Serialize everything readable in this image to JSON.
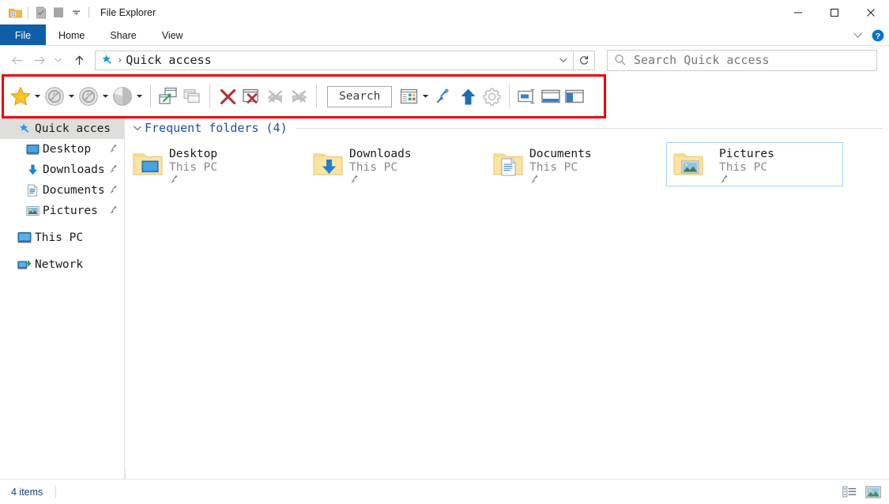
{
  "window": {
    "title": "File Explorer",
    "quick_access_toolbar": [
      {
        "name": "folder-icon",
        "label": "File Explorer"
      },
      {
        "name": "properties-icon",
        "label": "Properties"
      },
      {
        "name": "new-folder-icon",
        "label": "New folder"
      },
      {
        "name": "chevron-down-icon",
        "label": "Customize Quick Access Toolbar"
      }
    ],
    "controls": {
      "minimize": "—",
      "maximize": "□",
      "close": "✕"
    }
  },
  "ribbon": {
    "tabs": [
      {
        "label": "File",
        "active": true
      },
      {
        "label": "Home",
        "active": false
      },
      {
        "label": "Share",
        "active": false
      },
      {
        "label": "View",
        "active": false
      }
    ],
    "expand_icon": "chevron-down-icon",
    "help_icon": "help-icon"
  },
  "navigation": {
    "back_icon": "arrow-left-icon",
    "forward_icon": "arrow-right-icon",
    "recent_icon": "chevron-down-icon",
    "up_icon": "arrow-up-icon",
    "address": {
      "crumb_icon": "quick-access-star-icon",
      "separator": "›",
      "path": "Quick access",
      "dropdown_icon": "chevron-down-icon"
    },
    "refresh_icon": "refresh-icon",
    "search": {
      "icon": "search-icon",
      "placeholder": "Search Quick access",
      "value": ""
    }
  },
  "toolbar": {
    "highlight_color": "#f00000",
    "search_button_label": "Search",
    "items": [
      {
        "name": "favorites-star-icon",
        "label": "Favorites",
        "enabled": true,
        "caret": true
      },
      {
        "name": "no-entry-disabled-icon-1",
        "label": "Blocked",
        "enabled": false,
        "caret": true
      },
      {
        "name": "no-entry-disabled-icon-2",
        "label": "Blocked",
        "enabled": false,
        "caret": true
      },
      {
        "name": "globe-disabled-icon",
        "label": "Globe",
        "enabled": false,
        "caret": true
      },
      {
        "name": "new-window-icon",
        "label": "New window",
        "enabled": true,
        "caret": false
      },
      {
        "name": "duplicate-window-icon",
        "label": "Duplicate window",
        "enabled": false,
        "caret": false
      },
      {
        "name": "close-x-icon",
        "label": "Close",
        "enabled": true,
        "caret": false
      },
      {
        "name": "close-window-icon",
        "label": "Close window",
        "enabled": true,
        "caret": false
      },
      {
        "name": "clear-back-disabled-icon",
        "label": "Clear back",
        "enabled": false,
        "caret": false
      },
      {
        "name": "clear-forward-disabled-icon",
        "label": "Clear forward",
        "enabled": false,
        "caret": false
      },
      {
        "name": "view-options-icon",
        "label": "View options",
        "enabled": true,
        "caret": true
      },
      {
        "name": "pin-icon",
        "label": "Pin",
        "enabled": true,
        "caret": false
      },
      {
        "name": "up-arrow-icon",
        "label": "Up one level",
        "enabled": true,
        "caret": false
      },
      {
        "name": "settings-gear-icon",
        "label": "Settings",
        "enabled": true,
        "caret": false
      },
      {
        "name": "pane-center-icon",
        "label": "Center pane",
        "enabled": true,
        "caret": false
      },
      {
        "name": "pane-bottom-icon",
        "label": "Bottom pane",
        "enabled": true,
        "caret": false
      },
      {
        "name": "pane-left-icon",
        "label": "Left pane",
        "enabled": true,
        "caret": false
      }
    ]
  },
  "sidebar": {
    "items": [
      {
        "label": "Quick acces",
        "icon": "quick-access-star-icon",
        "level": 0,
        "selected": true,
        "pinned": false
      },
      {
        "label": "Desktop",
        "icon": "desktop-icon",
        "level": 1,
        "selected": false,
        "pinned": true
      },
      {
        "label": "Downloads",
        "icon": "downloads-arrow-icon",
        "level": 1,
        "selected": false,
        "pinned": true
      },
      {
        "label": "Documents",
        "icon": "documents-icon",
        "level": 1,
        "selected": false,
        "pinned": true
      },
      {
        "label": "Pictures",
        "icon": "pictures-icon",
        "level": 1,
        "selected": false,
        "pinned": true
      },
      {
        "label": "This PC",
        "icon": "this-pc-icon",
        "level": 0,
        "selected": false,
        "pinned": false
      },
      {
        "label": "Network",
        "icon": "network-icon",
        "level": 0,
        "selected": false,
        "pinned": false
      }
    ]
  },
  "main": {
    "section": {
      "title": "Frequent folders (4)",
      "collapse_icon": "chevron-down-icon"
    },
    "tiles": [
      {
        "name": "Desktop",
        "subtitle": "This PC",
        "icon": "folder-desktop-icon",
        "pinned": true,
        "selected": false
      },
      {
        "name": "Downloads",
        "subtitle": "This PC",
        "icon": "folder-downloads-icon",
        "pinned": true,
        "selected": false
      },
      {
        "name": "Documents",
        "subtitle": "This PC",
        "icon": "folder-documents-icon",
        "pinned": true,
        "selected": false
      },
      {
        "name": "Pictures",
        "subtitle": "This PC",
        "icon": "folder-pictures-icon",
        "pinned": true,
        "selected": true
      }
    ]
  },
  "statusbar": {
    "item_count": "4 items",
    "views": [
      {
        "name": "details-view-icon",
        "label": "Details view",
        "active": false
      },
      {
        "name": "large-icons-view-icon",
        "label": "Large icons view",
        "active": true
      }
    ]
  }
}
